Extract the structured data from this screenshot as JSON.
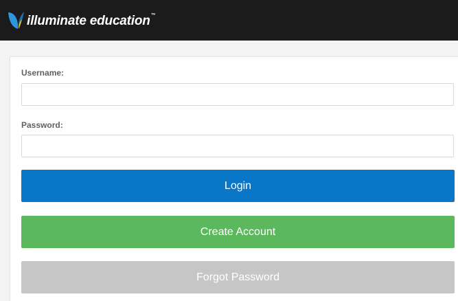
{
  "header": {
    "logo_text": "illuminate education",
    "logo_tm": "™",
    "logo_icon": "butterfly-logo-icon"
  },
  "form": {
    "username_label": "Username:",
    "username_value": "",
    "password_label": "Password:",
    "password_value": "",
    "login_label": "Login",
    "create_account_label": "Create Account",
    "forgot_password_label": "Forgot Password"
  },
  "colors": {
    "header_bg": "#1b1b1b",
    "login_bg": "#0a76c8",
    "create_account_bg": "#5cb85c",
    "forgot_password_bg": "#c6c6c6",
    "logo_blue": "#2f95dc",
    "logo_yellow": "#f2c200"
  }
}
